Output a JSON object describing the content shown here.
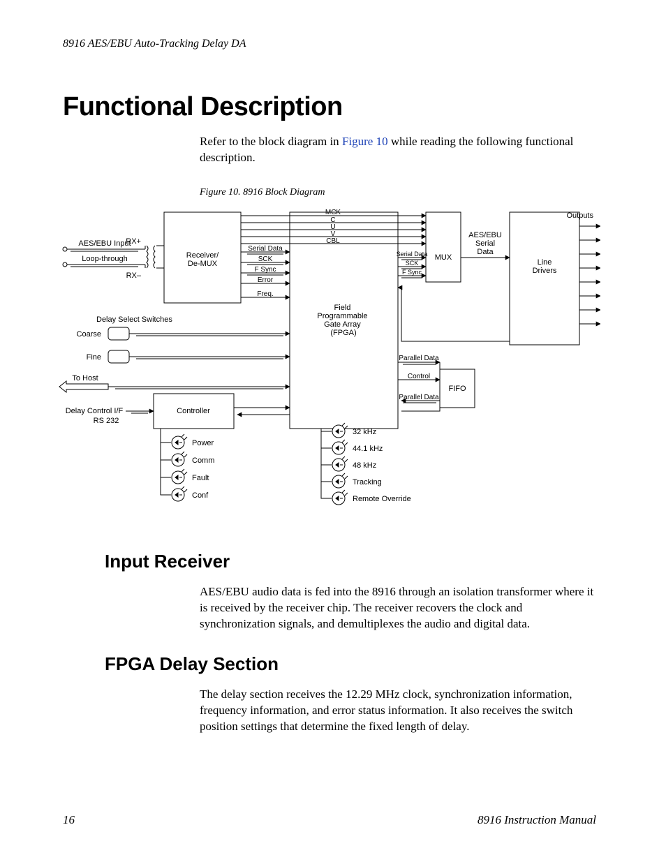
{
  "running_head": "8916 AES/EBU Auto-Tracking Delay DA",
  "section_title": "Functional Description",
  "intro_pre": "Refer to the block diagram in ",
  "intro_link": "Figure 10",
  "intro_post": " while reading the following functional description.",
  "fig_caption": "Figure 10.  8916 Block Diagram",
  "diagram": {
    "inputs": {
      "aes": "AES/EBU Input",
      "loop": "Loop-through",
      "rxp": "RX+",
      "rxm": "RX–"
    },
    "receiver": "Receiver/\nDe-MUX",
    "rx_out": [
      "Serial Data",
      "SCK",
      "F Sync",
      "Error",
      "Freq."
    ],
    "mck_group": [
      "MCK",
      "C",
      "U",
      "V",
      "CBL"
    ],
    "fpga": "Field\nProgrammable\nGate Array\n(FPGA)",
    "fpga_out": [
      "Serial Data",
      "SCK",
      "F Sync"
    ],
    "mux": "MUX",
    "mux_label": "AES/EBU\nSerial\nData",
    "line_drivers": "Line\nDrivers",
    "outputs": "Outputs",
    "switches_title": "Delay Select Switches",
    "coarse": "Coarse",
    "fine": "Fine",
    "to_host": "To Host",
    "controller": "Controller",
    "delay_if": "Delay Control I/F",
    "rs232": "RS 232",
    "fifo": "FIFO",
    "fifo_sig": [
      "Parallel Data",
      "Control",
      "Parallel Data"
    ],
    "leds_left": [
      "Power",
      "Comm",
      "Fault",
      "Conf"
    ],
    "leds_right": [
      "32 kHz",
      "44.1 kHz",
      "48 kHz",
      "Tracking",
      "Remote Override"
    ]
  },
  "sub1_title": "Input Receiver",
  "sub1_body": "AES/EBU audio data is fed into the 8916 through an isolation transformer where it is received by the receiver chip. The receiver recovers the clock and synchronization signals, and demultiplexes the audio and digital data.",
  "sub2_title": "FPGA Delay Section",
  "sub2_body": "The delay section receives the 12.29 MHz clock, synchronization information, frequency information, and error status information. It also receives the switch position settings that determine the fixed length of delay.",
  "footer_page": "16",
  "footer_doc": "8916 Instruction Manual"
}
